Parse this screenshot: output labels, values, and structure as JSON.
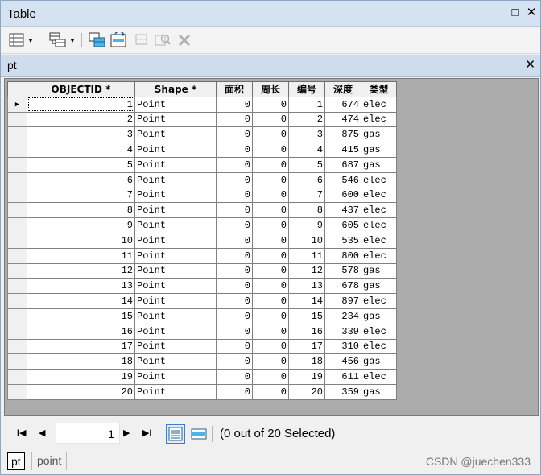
{
  "window": {
    "title": "Table",
    "maximize_glyph": "□",
    "close_glyph": "✕"
  },
  "toolbar": {
    "icons": [
      "table-options-icon",
      "related-tables-icon",
      "select-by-attributes-icon",
      "switch-selection-icon",
      "clear-selection-icon",
      "zoom-to-selected-icon",
      "delete-selected-icon"
    ]
  },
  "table_tab": {
    "name": "pt",
    "close_glyph": "✕"
  },
  "grid": {
    "columns": [
      "OBJECTID *",
      "Shape *",
      "面积",
      "周长",
      "编号",
      "深度",
      "类型"
    ],
    "current_row_marker": "▶",
    "rows": [
      [
        "1",
        "Point",
        "0",
        "0",
        "1",
        "674",
        "elec"
      ],
      [
        "2",
        "Point",
        "0",
        "0",
        "2",
        "474",
        "elec"
      ],
      [
        "3",
        "Point",
        "0",
        "0",
        "3",
        "875",
        "gas"
      ],
      [
        "4",
        "Point",
        "0",
        "0",
        "4",
        "415",
        "gas"
      ],
      [
        "5",
        "Point",
        "0",
        "0",
        "5",
        "687",
        "gas"
      ],
      [
        "6",
        "Point",
        "0",
        "0",
        "6",
        "546",
        "elec"
      ],
      [
        "7",
        "Point",
        "0",
        "0",
        "7",
        "600",
        "elec"
      ],
      [
        "8",
        "Point",
        "0",
        "0",
        "8",
        "437",
        "elec"
      ],
      [
        "9",
        "Point",
        "0",
        "0",
        "9",
        "605",
        "elec"
      ],
      [
        "10",
        "Point",
        "0",
        "0",
        "10",
        "535",
        "elec"
      ],
      [
        "11",
        "Point",
        "0",
        "0",
        "11",
        "800",
        "elec"
      ],
      [
        "12",
        "Point",
        "0",
        "0",
        "12",
        "578",
        "gas"
      ],
      [
        "13",
        "Point",
        "0",
        "0",
        "13",
        "678",
        "gas"
      ],
      [
        "14",
        "Point",
        "0",
        "0",
        "14",
        "897",
        "elec"
      ],
      [
        "15",
        "Point",
        "0",
        "0",
        "15",
        "234",
        "gas"
      ],
      [
        "16",
        "Point",
        "0",
        "0",
        "16",
        "339",
        "elec"
      ],
      [
        "17",
        "Point",
        "0",
        "0",
        "17",
        "310",
        "elec"
      ],
      [
        "18",
        "Point",
        "0",
        "0",
        "18",
        "456",
        "gas"
      ],
      [
        "19",
        "Point",
        "0",
        "0",
        "19",
        "611",
        "elec"
      ],
      [
        "20",
        "Point",
        "0",
        "0",
        "20",
        "359",
        "gas"
      ]
    ]
  },
  "navigation": {
    "first_glyph": "I◀",
    "prev_glyph": "◀",
    "current_record": "1",
    "next_glyph": "▶",
    "last_glyph": "▶I",
    "status_text": "(0 out of 20 Selected)"
  },
  "bottom_tabs": [
    {
      "label": "pt",
      "active": true
    },
    {
      "label": "point",
      "active": false
    }
  ],
  "watermark": "CSDN @juechen333",
  "colors": {
    "titlebar": "#d5e2f2",
    "tabbar": "#cfdcee",
    "grid_background": "#ababab",
    "accent": "#3a7bd5"
  }
}
